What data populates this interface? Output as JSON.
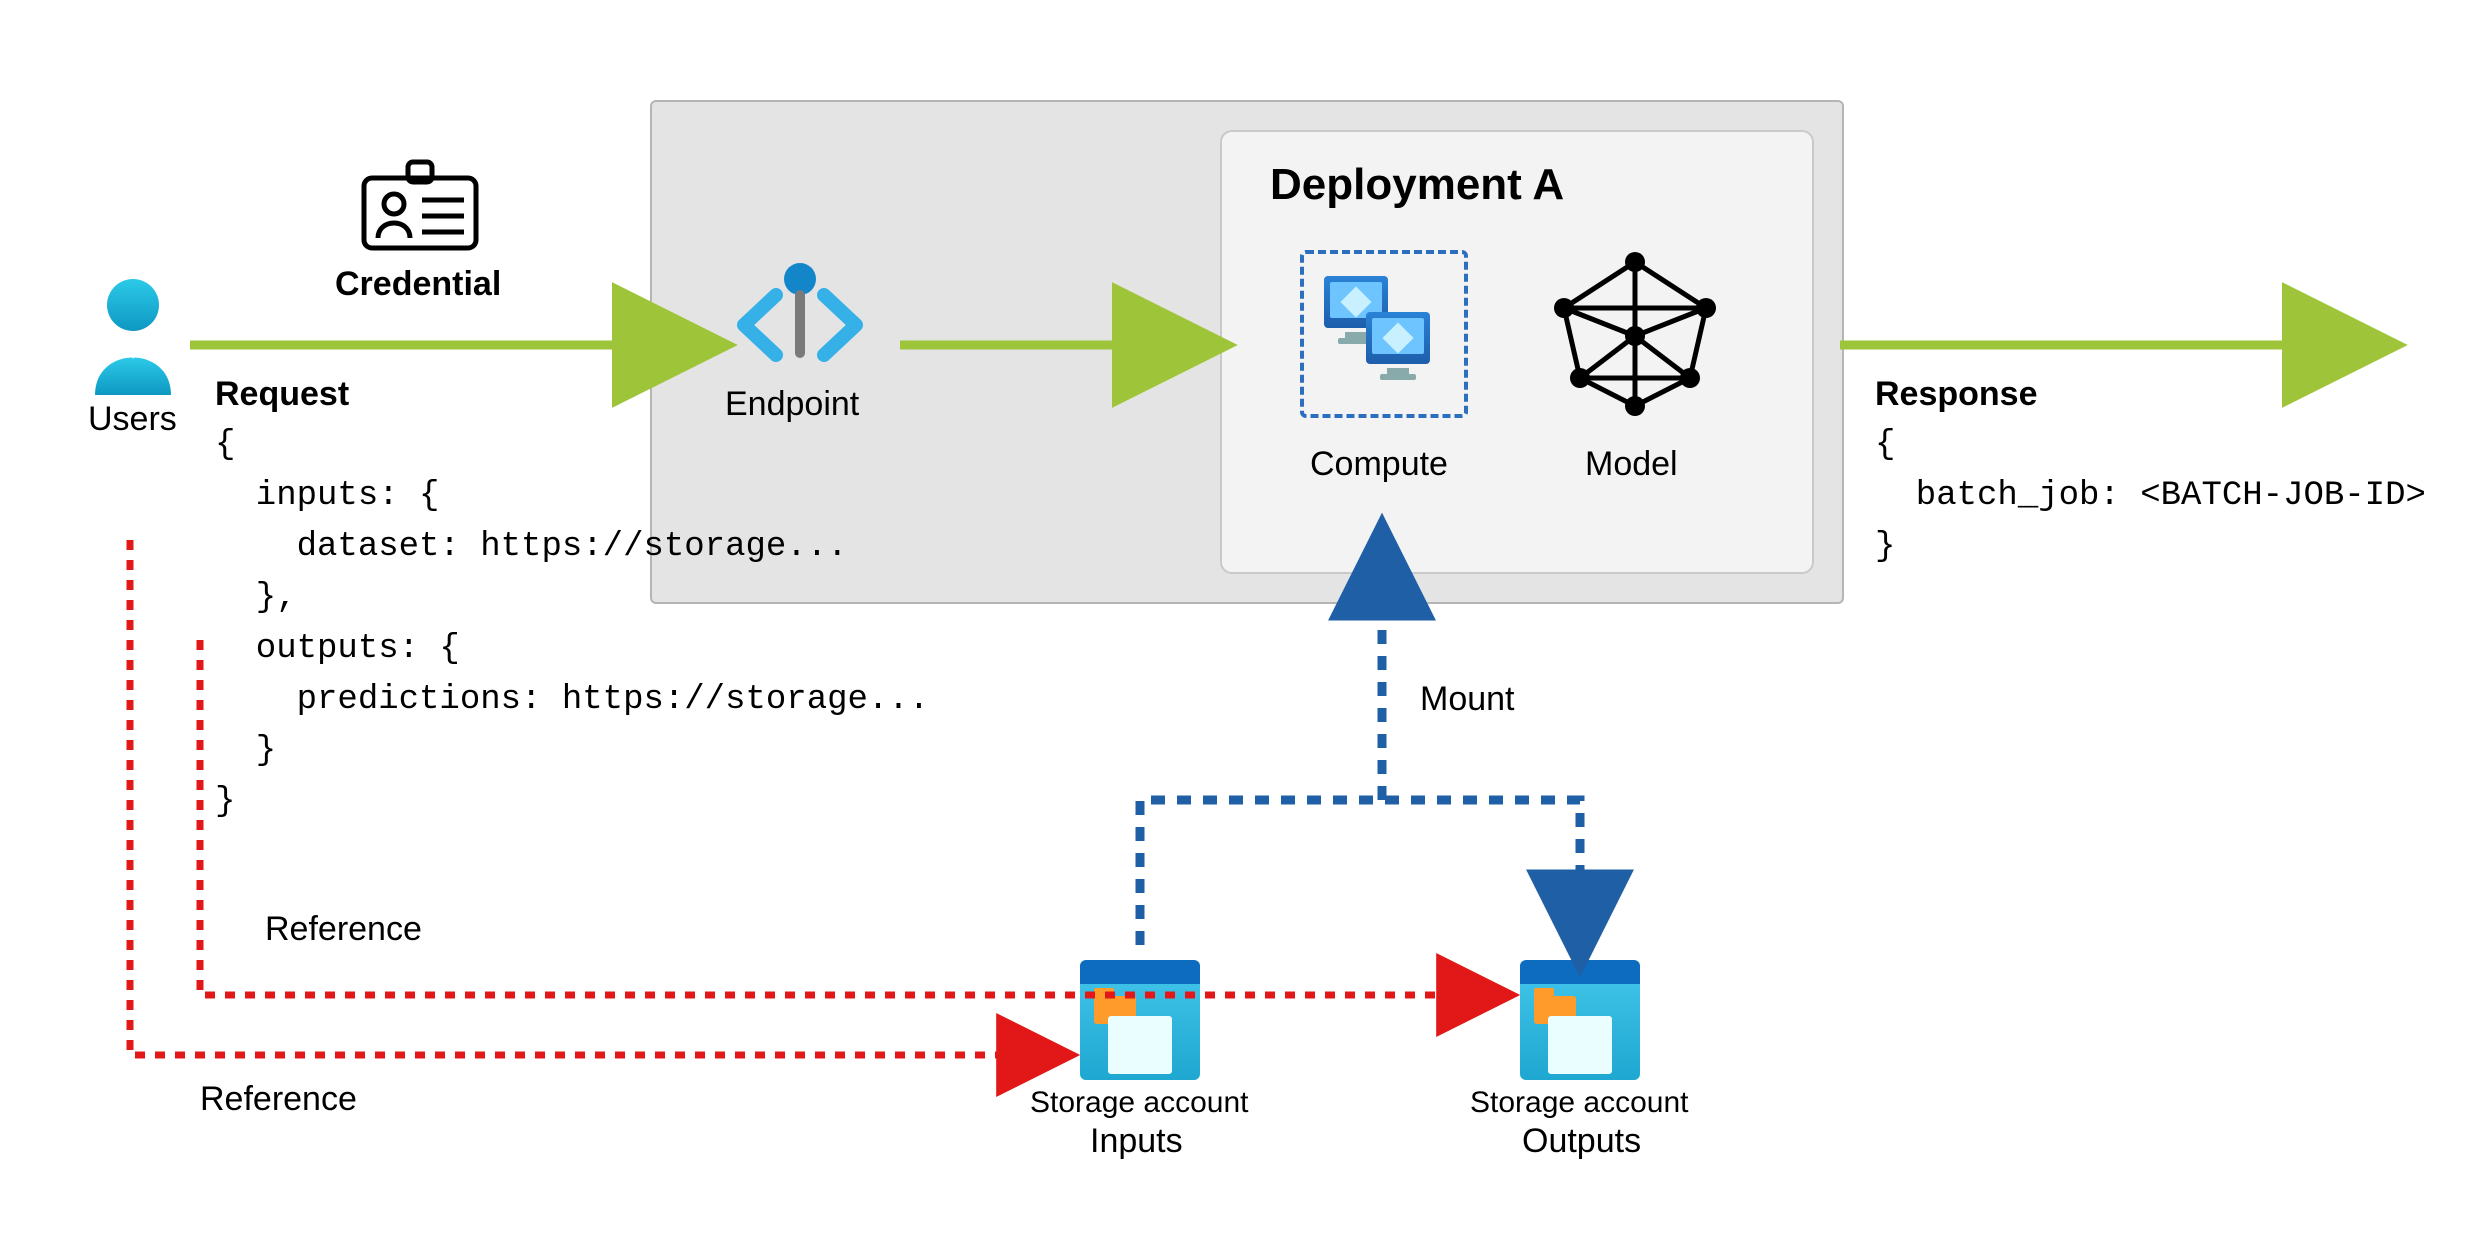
{
  "users_label": "Users",
  "credential_label": "Credential",
  "request_label": "Request",
  "request_body": "{\n  inputs: {\n    dataset: https://storage...\n  },\n  outputs: {\n    predictions: https://storage...\n  }\n}",
  "endpoint_label": "Endpoint",
  "deployment_title": "Deployment A",
  "compute_label": "Compute",
  "model_label": "Model",
  "response_label": "Response",
  "response_body": "{\n  batch_job: <BATCH-JOB-ID>\n}",
  "mount_label": "Mount",
  "reference1_label": "Reference",
  "reference2_label": "Reference",
  "storage_in_label1": "Storage account",
  "storage_in_label2": "Inputs",
  "storage_out_label1": "Storage account",
  "storage_out_label2": "Outputs",
  "colors": {
    "flow": "#9EC53A",
    "mount": "#1F5FA6",
    "reference": "#E21818"
  }
}
